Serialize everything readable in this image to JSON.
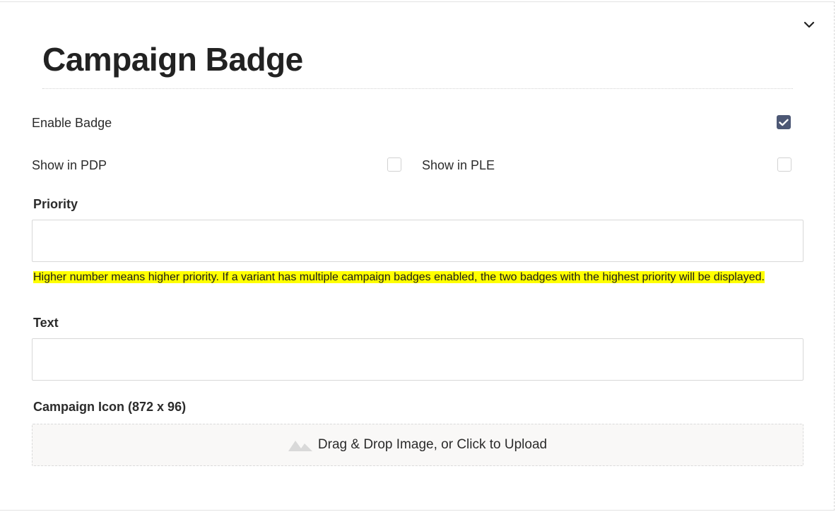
{
  "section": {
    "title": "Campaign Badge",
    "toggle_icon": "chevron-down-icon"
  },
  "enable_badge": {
    "label": "Enable Badge",
    "checked": true
  },
  "show_in_pdp": {
    "label": "Show in PDP",
    "checked": false
  },
  "show_in_ple": {
    "label": "Show in PLE",
    "checked": false
  },
  "priority": {
    "label": "Priority",
    "value": "",
    "help": "Higher number means higher priority. If a variant has multiple campaign badges enabled, the two badges with the highest priority will be displayed."
  },
  "text_field": {
    "label": "Text",
    "value": ""
  },
  "campaign_icon": {
    "label": "Campaign Icon (872 x 96)",
    "dropzone_text": "Drag & Drop Image, or Click to Upload",
    "dropzone_icon": "image-placeholder-icon"
  },
  "colors": {
    "checkbox_checked": "#4d5875",
    "highlight": "#ffff00",
    "dropzone_bg": "#f9f8f7"
  }
}
